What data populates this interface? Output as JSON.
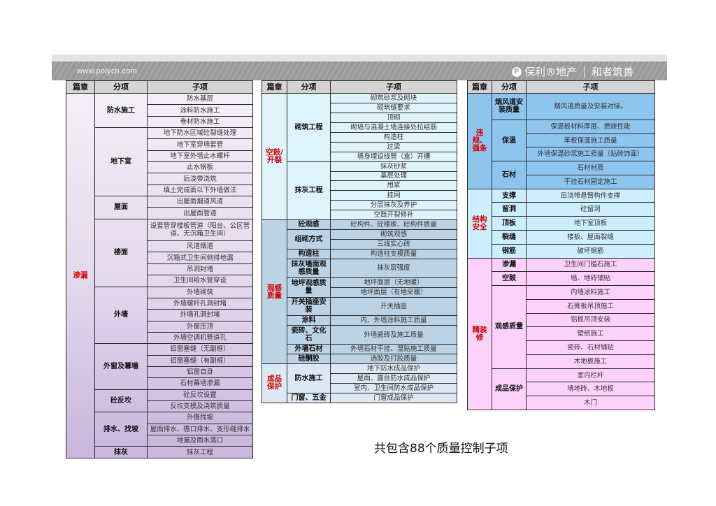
{
  "banner": {
    "url": "www.polycn.com",
    "logo_mark": "P",
    "brand": "保利®地产",
    "slogan": "和者筑善"
  },
  "headers": [
    "篇章",
    "分项",
    "子项"
  ],
  "caption": "共包含88个质量控制子项",
  "colors": {
    "chapter": "#d40000",
    "t0": "#e4d9ee",
    "t1s0": "#dff3fb",
    "t1s1": "#bcd3e6",
    "t1s2": "#dce9f4",
    "t2s0": "#8ec5ef",
    "t2s1": "#cdeefc",
    "t2s2": "#fcd2fa"
  },
  "tables": [
    {
      "sections": [
        {
          "chapter": "渗漏",
          "color": "t0",
          "groups": [
            {
              "name": "防水施工",
              "items": [
                "防水基层",
                "涂料防水施工",
                "卷材防水施工"
              ]
            },
            {
              "name": "地下室",
              "items": [
                "地下防水区域砼裂缝处理",
                "地下室穿墙套管",
                "地下室外墙止水螺杆",
                "止水钢板",
                "后浇带浇筑",
                "填土完成面以下外墙做法"
              ]
            },
            {
              "name": "屋面",
              "items": [
                "出屋面烟道风道",
                "出屋面管道"
              ]
            },
            {
              "name": "楼面",
              "items": [
                "设套管穿楼板管道（阳台、公区管道、无沉箱卫生间）",
                "风道烟道",
                "沉箱式卫生间侧排地漏",
                "吊洞封堵",
                "卫生间给水管穿设"
              ]
            },
            {
              "name": "外墙",
              "items": [
                "外墙砌筑",
                "外墙螺杆孔洞封堵",
                "外墙孔洞封堵",
                "外窗压顶",
                "外墙空调机管道孔"
              ]
            },
            {
              "name": "外窗及幕墙",
              "items": [
                "铝窗塞缝（无副框）",
                "铝窗塞缝（有副框）",
                "铝窗自身",
                "石材幕墙渗漏"
              ]
            },
            {
              "name": "砼反坎",
              "items": [
                "砼反坎设置",
                "反坎支模及浇筑质量"
              ]
            },
            {
              "name": "排水、找坡",
              "items": [
                "外檐找坡",
                "屋面排水、檐口排水、变形缝排水",
                "地漏及雨水落口"
              ]
            },
            {
              "name": "抹灰",
              "items": [
                "抹灰工程"
              ]
            }
          ]
        }
      ]
    },
    {
      "sections": [
        {
          "chapter": "空鼓/开裂",
          "color": "t1s0",
          "groups": [
            {
              "name": "砌筑工程",
              "items": [
                "砌筑砂浆及砌块",
                "砌筑缝要求",
                "顶砌",
                "砌墙与混凝土墙连接处拉结筋",
                "构造柱",
                "过梁",
                "墙身埋设线管（盒）开槽"
              ]
            },
            {
              "name": "抹灰工程",
              "items": [
                "抹灰砂浆",
                "基层处理",
                "甩浆",
                "挂网",
                "分层抹灰及养护",
                "空鼓开裂修补"
              ]
            }
          ]
        },
        {
          "chapter": "观感质量",
          "color": "t1s1",
          "groups": [
            {
              "name": "砼观感",
              "items": [
                "砼构件、砼楼板、砼构件质量"
              ]
            },
            {
              "name": "组砌方式",
              "items": [
                "砌筑观感",
                "三线实心砖"
              ]
            },
            {
              "name": "构造柱",
              "items": [
                "构造柱支模质量"
              ]
            },
            {
              "name": "抹灰墙面观感质量",
              "items": [
                "抹灰层强度"
              ]
            },
            {
              "name": "地坪观感质量",
              "items": [
                "地坪面层（无地暖）",
                "地坪面层（有地采暖）"
              ]
            },
            {
              "name": "开关插座安装",
              "items": [
                "开关插座"
              ]
            },
            {
              "name": "涂料",
              "items": [
                "内、外墙涂料施工质量"
              ]
            },
            {
              "name": "瓷砖、文化石",
              "items": [
                "外墙瓷砖及施工质量"
              ]
            },
            {
              "name": "外墙石材",
              "items": [
                "外墙石材干挂、湿贴施工质量"
              ]
            },
            {
              "name": "硅酮胶",
              "items": [
                "选胶及打胶质量"
              ]
            }
          ]
        },
        {
          "chapter": "成品保护",
          "color": "t1s2",
          "groups": [
            {
              "name": "防水施工",
              "items": [
                "地下防水成品保护",
                "屋面、露台防水成品保护",
                "室内、卫生间防水成品保护"
              ]
            },
            {
              "name": "门窗、五金",
              "items": [
                "门窗成品保护"
              ]
            }
          ]
        }
      ]
    },
    {
      "sections": [
        {
          "chapter": "违规、强条",
          "color": "t2s0",
          "groups": [
            {
              "name": "烟风道安装质量",
              "items": [
                "烟风道质量及安装对接。"
              ]
            },
            {
              "name": "保温",
              "items": [
                "保温板材料厚度、燃烧性能",
                "苯板保温施工质量",
                "外墙保温砂浆施工质量（贴砖饰面）"
              ]
            },
            {
              "name": "石材",
              "items": [
                "石材材质",
                "干挂石材固定施工"
              ]
            }
          ]
        },
        {
          "chapter": "结构安全",
          "color": "t2s1",
          "groups": [
            {
              "name": "支撑",
              "items": [
                "后浇带悬臂构件支撑"
              ]
            },
            {
              "name": "留洞",
              "items": [
                "砼留洞"
              ]
            },
            {
              "name": "顶板",
              "items": [
                "地下室顶板"
              ]
            },
            {
              "name": "裂缝",
              "items": [
                "楼板、屋面裂缝"
              ]
            },
            {
              "name": "钢筋",
              "items": [
                "破坏钢筋"
              ]
            }
          ]
        },
        {
          "chapter": "精装修",
          "color": "t2s2",
          "groups": [
            {
              "name": "渗漏",
              "items": [
                "卫生间门槛石施工"
              ]
            },
            {
              "name": "空鼓",
              "items": [
                "墙、地砖铺贴"
              ]
            },
            {
              "name": "观感质量",
              "items": [
                "内墙涂料施工",
                "石膏板吊顶施工",
                "铝板吊顶安装",
                "壁纸施工",
                "瓷砖、石材铺贴",
                "木地板施工"
              ]
            },
            {
              "name": "成品保护",
              "items": [
                "室内栏杆",
                "墙地砖、木地板",
                "木门"
              ]
            }
          ]
        }
      ]
    }
  ]
}
